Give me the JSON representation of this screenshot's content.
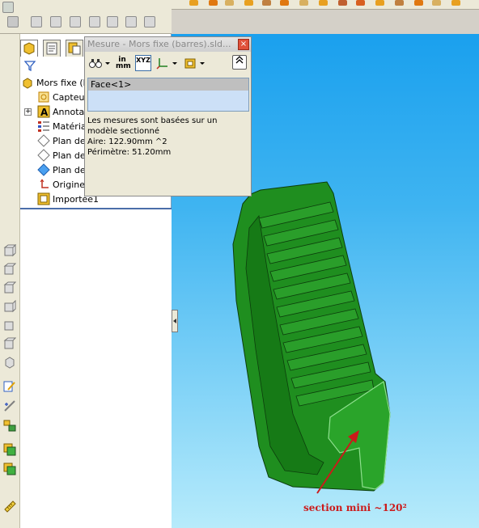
{
  "feature_tree": {
    "items": [
      {
        "label": "Mors fixe (b",
        "icon": "part-icon"
      },
      {
        "label": "Capteu",
        "icon": "sensor-icon"
      },
      {
        "label": "Annota",
        "icon": "annotation-icon"
      },
      {
        "label": "Matéria",
        "icon": "material-icon"
      },
      {
        "label": "Plan de",
        "icon": "plane-icon"
      },
      {
        "label": "Plan de",
        "icon": "plane-icon"
      },
      {
        "label": "Plan de",
        "icon": "plane-icon"
      },
      {
        "label": "Origine",
        "icon": "origin-icon"
      },
      {
        "label": "Importée1",
        "icon": "imported-body-icon"
      }
    ]
  },
  "measure_dialog": {
    "title": "Mesure - Mors fixe (barres).sld...",
    "close": "×",
    "units_label": "in\nmm",
    "xyz_label": "XYZ",
    "selection": [
      "Face<1>"
    ],
    "results": {
      "note": "Les mesures sont basées sur un modèle sectionné",
      "area": "Aire: 122.90mm ^2",
      "perimeter": "Périmètre: 51.20mm"
    }
  },
  "annotation": {
    "text": "section mini ~120²",
    "color": "#cc1a1a"
  },
  "colors": {
    "viewport_top": "#1aa0ee",
    "viewport_bottom": "#b7ebfb",
    "part_green": "#1f8e1f",
    "selected_face": "#2aa42a"
  }
}
